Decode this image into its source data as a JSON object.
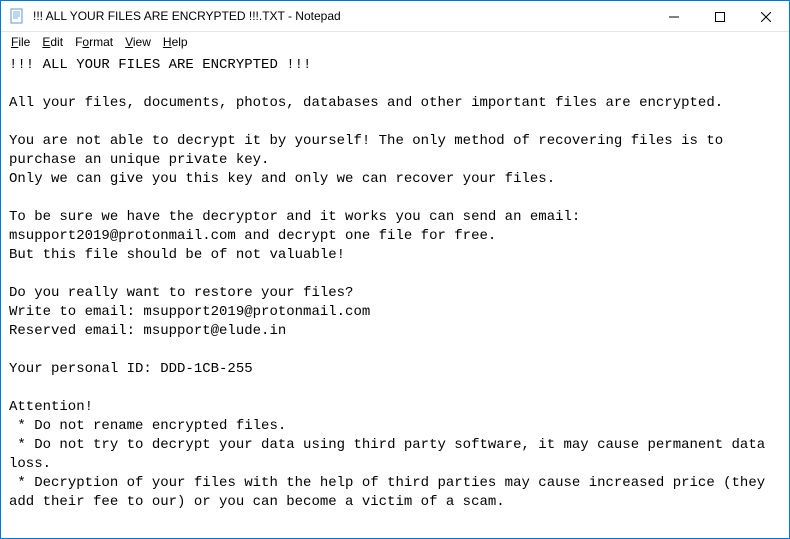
{
  "titlebar": {
    "title": "!!! ALL YOUR FILES ARE ENCRYPTED !!!.TXT - Notepad"
  },
  "menubar": {
    "file": "File",
    "edit": "Edit",
    "format": "Format",
    "view": "View",
    "help": "Help"
  },
  "content": {
    "text": "!!! ALL YOUR FILES ARE ENCRYPTED !!!\n\nAll your files, documents, photos, databases and other important files are encrypted.\n\nYou are not able to decrypt it by yourself! The only method of recovering files is to purchase an unique private key.\nOnly we can give you this key and only we can recover your files.\n\nTo be sure we have the decryptor and it works you can send an email: msupport2019@protonmail.com and decrypt one file for free.\nBut this file should be of not valuable!\n\nDo you really want to restore your files?\nWrite to email: msupport2019@protonmail.com\nReserved email: msupport@elude.in\n\nYour personal ID: DDD-1CB-255\n\nAttention!\n * Do not rename encrypted files.\n * Do not try to decrypt your data using third party software, it may cause permanent data loss.\n * Decryption of your files with the help of third parties may cause increased price (they add their fee to our) or you can become a victim of a scam."
  }
}
